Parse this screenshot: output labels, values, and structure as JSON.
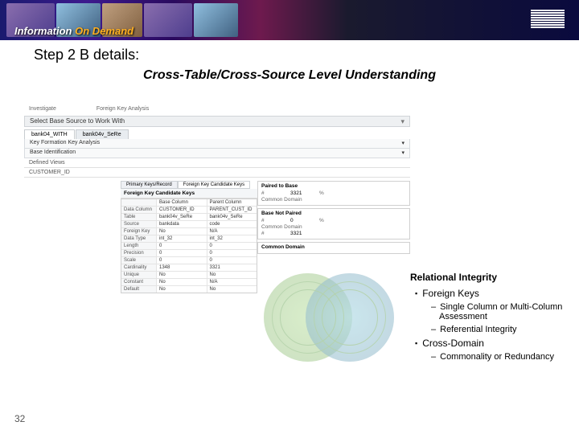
{
  "banner": {
    "brand_pre": "Information",
    "brand_post": "On Demand",
    "ibm": "IBM"
  },
  "step_label": "Step 2 B details:",
  "subtitle": "Cross-Table/Cross-Source Level Understanding",
  "shot": {
    "crumb1": "Investigate",
    "crumb2": "Foreign Key Analysis",
    "select_bar": "Select Base Source to Work With",
    "tabs": [
      "bank04_WITH",
      "bank04v_SeRe"
    ],
    "rows": [
      {
        "l": "Key Formation Key Analysis",
        "r": ""
      },
      {
        "l": "Base Identification",
        "r": ""
      }
    ],
    "defined_view": "Defined Views",
    "defined_value": "CUSTOMER_ID",
    "mini_tabs": [
      "Primary Keys/Record",
      "Foreign Key Candidate Keys"
    ],
    "mini_header": "Foreign Key Candidate Keys",
    "kv_cols": [
      "",
      "Base Column",
      "Parent Column"
    ],
    "kv": [
      {
        "k": "Data Column",
        "v1": "CUSTOMER_ID",
        "v2": "PARENT_CUST_ID"
      },
      {
        "k": "Table",
        "v1": "bank04v_SeRe",
        "v2": "bank04v_SeRe"
      },
      {
        "k": "Source",
        "v1": "bankdata",
        "v2": "code"
      },
      {
        "k": "Foreign Key",
        "v1": "No",
        "v2": "N/A"
      },
      {
        "k": "Data Type",
        "v1": "int_32",
        "v2": "int_32"
      },
      {
        "k": "Length",
        "v1": "0",
        "v2": "0"
      },
      {
        "k": "Precision",
        "v1": "0",
        "v2": "0"
      },
      {
        "k": "Scale",
        "v1": "0",
        "v2": "0"
      },
      {
        "k": "Cardinality",
        "v1": "1348",
        "v2": "3321"
      },
      {
        "k": "Unique",
        "v1": "No",
        "v2": "No"
      },
      {
        "k": "Constant",
        "v1": "No",
        "v2": "N/A"
      },
      {
        "k": "Default",
        "v1": "No",
        "v2": "No"
      }
    ],
    "paired": {
      "title": "Paired to Base",
      "rows1": [
        {
          "c1": "#",
          "c2": "3321",
          "c3": "%"
        },
        {
          "c1": "",
          "c2": "",
          "c3": "Common Domain"
        }
      ],
      "title2": "Base Not Paired",
      "rows2": [
        {
          "c1": "#",
          "c2": "0",
          "c3": "%"
        },
        {
          "c1": "",
          "c2": "",
          "c3": "Common Domain"
        }
      ],
      "rows3": [
        {
          "c1": "#",
          "c2": "3321",
          "c3": ""
        }
      ],
      "common_title": "Common Domain"
    }
  },
  "panel": {
    "heading": "Relational Integrity",
    "items": [
      {
        "type": "sq",
        "text": "Foreign Keys"
      },
      {
        "type": "sub",
        "text": "Single Column or Multi-Column Assessment"
      },
      {
        "type": "sub",
        "text": "Referential Integrity"
      },
      {
        "type": "sq",
        "text": "Cross-Domain"
      },
      {
        "type": "sub",
        "text": "Commonality or Redundancy"
      }
    ]
  },
  "page_number": "32"
}
